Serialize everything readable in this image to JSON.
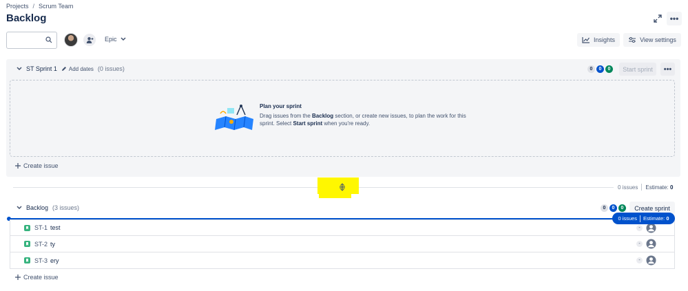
{
  "breadcrumb": {
    "projects": "Projects",
    "separator": "/",
    "team": "Scrum Team"
  },
  "page": {
    "title": "Backlog"
  },
  "toolbar": {
    "search_placeholder": "",
    "epic_label": "Epic",
    "insights_label": "Insights",
    "view_settings_label": "View settings",
    "more_label": "•••"
  },
  "sprint": {
    "name": "ST Sprint 1",
    "add_dates": "Add dates",
    "issue_count": "(0 issues)",
    "badges": [
      "0",
      "0",
      "0"
    ],
    "start_label": "Start sprint",
    "more_label": "•••",
    "empty_title": "Plan your sprint",
    "empty_text_1": "Drag issues from the ",
    "empty_text_bold_1": "Backlog",
    "empty_text_2": " section, or create new issues, to plan the work for this sprint. Select ",
    "empty_text_bold_2": "Start sprint",
    "empty_text_3": " when you're ready.",
    "create_issue": "Create issue"
  },
  "sprint_summary": {
    "issues": "0 issues",
    "estimate_label": "Estimate:",
    "estimate_value": "0"
  },
  "backlog": {
    "name": "Backlog",
    "issue_count": "(3 issues)",
    "badges": [
      "0",
      "0",
      "0"
    ],
    "create_sprint": "Create sprint",
    "drag_summary": {
      "issues": "0 issues",
      "estimate_label": "Estimate:",
      "estimate_value": "0"
    },
    "items": [
      {
        "key": "ST-1",
        "summary": "test",
        "estimate": "-"
      },
      {
        "key": "ST-2",
        "summary": "ty",
        "estimate": "-"
      },
      {
        "key": "ST-3",
        "summary": "ery",
        "estimate": "-"
      }
    ],
    "create_issue": "Create issue"
  },
  "colors": {
    "primary": "#0052cc",
    "success": "#00875a",
    "highlight": "#fff700",
    "story": "#36b37e"
  }
}
